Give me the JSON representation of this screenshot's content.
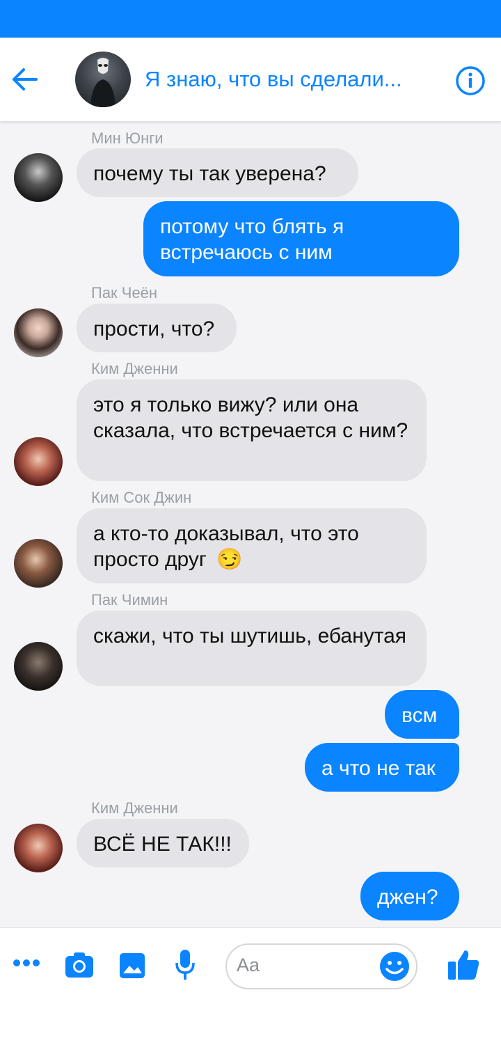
{
  "header": {
    "title": "Я знаю, что вы сделали..."
  },
  "messages": [
    {
      "sender": "Мин Юнги",
      "text": "почему ты так уверена?",
      "direction": "in"
    },
    {
      "text": "потому что блять я встречаюсь с ним",
      "direction": "out"
    },
    {
      "sender": "Пак Чеён",
      "text": "прости, что?",
      "direction": "in"
    },
    {
      "sender": "Ким Дженни",
      "text": "это я только вижу? или она сказала, что встречается с ним?",
      "direction": "in"
    },
    {
      "sender": "Ким Сок Джин",
      "text": "а кто-то доказывал, что это просто друг",
      "emoji": "😏",
      "direction": "in"
    },
    {
      "sender": "Пак Чимин",
      "text": "скажи, что ты шутишь, ебанутая",
      "direction": "in"
    },
    {
      "text": "всм",
      "direction": "out"
    },
    {
      "text": "а что не так",
      "direction": "out"
    },
    {
      "sender": "Ким Дженни",
      "text": "ВСЁ НЕ ТАК!!!",
      "direction": "in"
    },
    {
      "text": "джен?",
      "direction": "out"
    }
  ],
  "composer": {
    "placeholder": "Aa",
    "icons": [
      "more-icon",
      "camera-icon",
      "image-icon",
      "microphone-icon",
      "emoji-icon",
      "like-icon"
    ]
  },
  "colors": {
    "accent": "#0a84ff",
    "incoming_bubble": "#e4e4e8",
    "background": "#f4f4f6"
  }
}
